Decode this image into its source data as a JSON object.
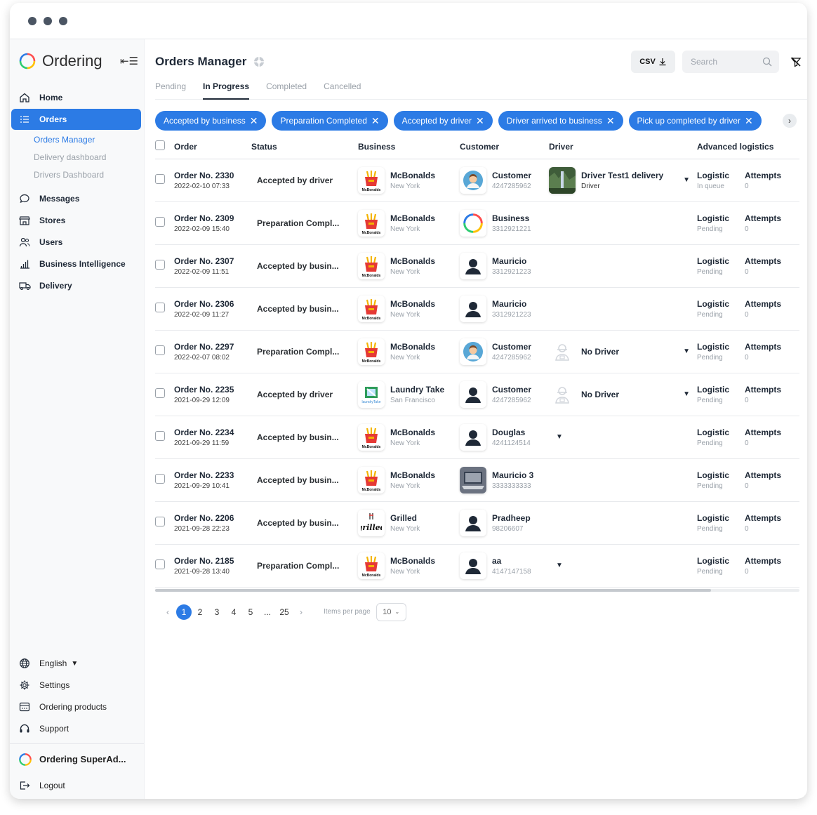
{
  "brand": {
    "name": "Ordering"
  },
  "nav": {
    "home": "Home",
    "orders": "Orders",
    "orders_sub": [
      "Orders Manager",
      "Delivery dashboard",
      "Drivers Dashboard"
    ],
    "messages": "Messages",
    "stores": "Stores",
    "users": "Users",
    "bi": "Business Intelligence",
    "delivery": "Delivery"
  },
  "bottom_nav": {
    "language": "English",
    "settings": "Settings",
    "products": "Ordering products",
    "support": "Support",
    "superadmin": "Ordering SuperAd...",
    "logout": "Logout"
  },
  "header": {
    "title": "Orders Manager",
    "csv_label": "CSV",
    "search_placeholder": "Search"
  },
  "tabs": [
    "Pending",
    "In Progress",
    "Completed",
    "Cancelled"
  ],
  "filter_chips": [
    "Accepted by business",
    "Preparation Completed",
    "Accepted by driver",
    "Driver arrived to business",
    "Pick up completed by driver"
  ],
  "columns": [
    "Order",
    "Status",
    "Business",
    "Customer",
    "Driver",
    "Advanced logistics"
  ],
  "orders": [
    {
      "no": "Order No. 2330",
      "date": "2022-02-10 07:33",
      "status": "Accepted by driver",
      "business": "McBonalds",
      "city": "New York",
      "blogo": "mc",
      "customer": "Customer",
      "phone": "4247285962",
      "cav": "customer",
      "driver": "Driver Test1 delivery",
      "driver_sub": "Driver",
      "dtype": "photo",
      "logistic": "Logistic",
      "log_status": "In queue",
      "attempts": "Attempts",
      "attempts_val": "0"
    },
    {
      "no": "Order No. 2309",
      "date": "2022-02-09 15:40",
      "status": "Preparation Compl...",
      "business": "McBonalds",
      "city": "New York",
      "blogo": "mc",
      "customer": "Business",
      "phone": "3312921221",
      "cav": "ring",
      "driver": "",
      "driver_sub": "",
      "dtype": "none",
      "logistic": "Logistic",
      "log_status": "Pending",
      "attempts": "Attempts",
      "attempts_val": "0"
    },
    {
      "no": "Order No. 2307",
      "date": "2022-02-09 11:51",
      "status": "Accepted by busin...",
      "business": "McBonalds",
      "city": "New York",
      "blogo": "mc",
      "customer": "Mauricio",
      "phone": "3312921223",
      "cav": "person",
      "driver": "",
      "driver_sub": "",
      "dtype": "none",
      "logistic": "Logistic",
      "log_status": "Pending",
      "attempts": "Attempts",
      "attempts_val": "0"
    },
    {
      "no": "Order No. 2306",
      "date": "2022-02-09 11:27",
      "status": "Accepted by busin...",
      "business": "McBonalds",
      "city": "New York",
      "blogo": "mc",
      "customer": "Mauricio",
      "phone": "3312921223",
      "cav": "person",
      "driver": "",
      "driver_sub": "",
      "dtype": "none",
      "logistic": "Logistic",
      "log_status": "Pending",
      "attempts": "Attempts",
      "attempts_val": "0"
    },
    {
      "no": "Order No. 2297",
      "date": "2022-02-07 08:02",
      "status": "Preparation Compl...",
      "business": "McBonalds",
      "city": "New York",
      "blogo": "mc",
      "customer": "Customer",
      "phone": "4247285962",
      "cav": "customer",
      "driver": "No Driver",
      "driver_sub": "",
      "dtype": "nodriver",
      "logistic": "Logistic",
      "log_status": "Pending",
      "attempts": "Attempts",
      "attempts_val": "0"
    },
    {
      "no": "Order No. 2235",
      "date": "2021-09-29 12:09",
      "status": "Accepted by driver",
      "business": "Laundry Take",
      "city": "San Francisco",
      "blogo": "laundry",
      "customer": "Customer",
      "phone": "4247285962",
      "cav": "person",
      "driver": "No Driver",
      "driver_sub": "",
      "dtype": "nodriver",
      "logistic": "Logistic",
      "log_status": "Pending",
      "attempts": "Attempts",
      "attempts_val": "0"
    },
    {
      "no": "Order No. 2234",
      "date": "2021-09-29 11:59",
      "status": "Accepted by busin...",
      "business": "McBonalds",
      "city": "New York",
      "blogo": "mc",
      "customer": "Douglas",
      "phone": "4241124514",
      "cav": "person",
      "driver": "",
      "driver_sub": "",
      "dtype": "caret",
      "logistic": "Logistic",
      "log_status": "Pending",
      "attempts": "Attempts",
      "attempts_val": "0"
    },
    {
      "no": "Order No. 2233",
      "date": "2021-09-29 10:41",
      "status": "Accepted by busin...",
      "business": "McBonalds",
      "city": "New York",
      "blogo": "mc",
      "customer": "Mauricio 3",
      "phone": "3333333333",
      "cav": "laptop",
      "driver": "",
      "driver_sub": "",
      "dtype": "none",
      "logistic": "Logistic",
      "log_status": "Pending",
      "attempts": "Attempts",
      "attempts_val": "0"
    },
    {
      "no": "Order No. 2206",
      "date": "2021-09-28 22:23",
      "status": "Accepted by busin...",
      "business": "Grilled",
      "city": "New York",
      "blogo": "grilled",
      "customer": "Pradheep",
      "phone": "98206607",
      "cav": "person",
      "driver": "",
      "driver_sub": "",
      "dtype": "none",
      "logistic": "Logistic",
      "log_status": "Pending",
      "attempts": "Attempts",
      "attempts_val": "0"
    },
    {
      "no": "Order No. 2185",
      "date": "2021-09-28 13:40",
      "status": "Preparation Compl...",
      "business": "McBonalds",
      "city": "New York",
      "blogo": "mc",
      "customer": "aa",
      "phone": "4147147158",
      "cav": "person",
      "driver": "",
      "driver_sub": "",
      "dtype": "caret",
      "logistic": "Logistic",
      "log_status": "Pending",
      "attempts": "Attempts",
      "attempts_val": "0"
    }
  ],
  "pagination": {
    "pages": [
      "1",
      "2",
      "3",
      "4",
      "5",
      "...",
      "25"
    ],
    "current": "1",
    "items_per_page_label": "Items per page",
    "items_per_page": "10"
  },
  "colors": {
    "accent": "#2c7be5"
  },
  "icons": {
    "nav": [
      "home-icon",
      "orders-list-icon",
      "message-icon",
      "store-icon",
      "users-icon",
      "chart-icon",
      "truck-icon"
    ],
    "bottom": [
      "globe-icon",
      "gear-icon",
      "products-icon",
      "headset-icon",
      "logout-icon"
    ]
  }
}
